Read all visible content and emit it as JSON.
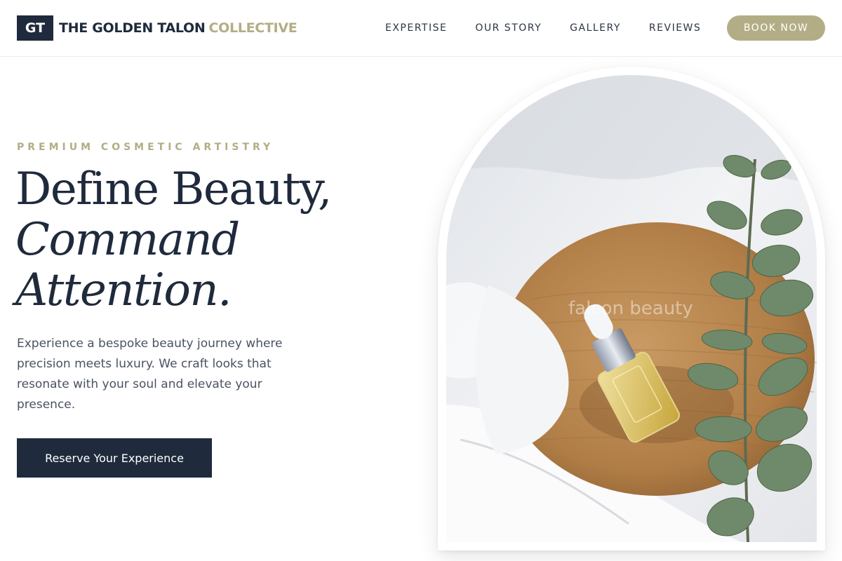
{
  "header": {
    "logo_badge": "GT",
    "logo_name": "THE GOLDEN TALON",
    "logo_accent": "COLLECTIVE",
    "nav": [
      "EXPERTISE",
      "OUR STORY",
      "GALLERY",
      "REVIEWS"
    ],
    "book_label": "BOOK NOW"
  },
  "hero": {
    "eyebrow": "PREMIUM COSMETIC ARTISTRY",
    "headline_line1": "Define Beauty,",
    "headline_line2": "Command",
    "headline_line3": "Attention.",
    "lead": "Experience a bespoke beauty journey where precision meets luxury. We craft looks that resonate with your soul and elevate your presence.",
    "cta_label": "Reserve Your Experience"
  },
  "image": {
    "watermark": "falcon beauty",
    "alt": "serum dropper bottle on a wooden tray with eucalyptus sprig over white linen"
  },
  "colors": {
    "navy": "#1f2a3c",
    "gold": "#b3ad86",
    "text_muted": "#4a5262"
  }
}
